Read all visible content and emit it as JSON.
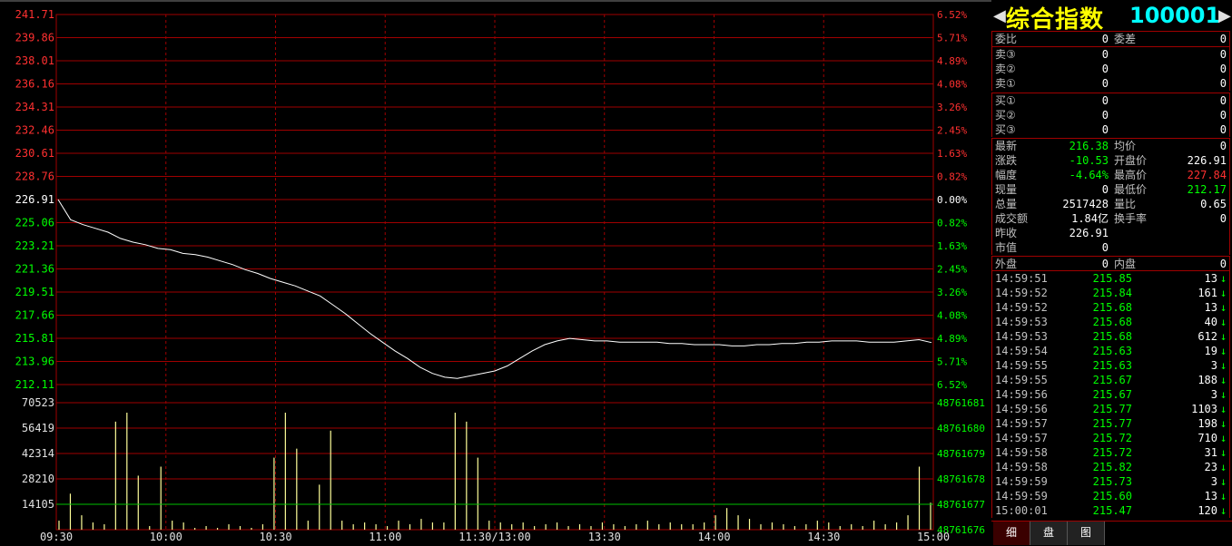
{
  "chart_data": {
    "type": "line",
    "price_axis": {
      "labels": [
        "241.71",
        "239.86",
        "238.01",
        "236.16",
        "234.31",
        "232.46",
        "230.61",
        "228.76",
        "226.91",
        "225.06",
        "223.21",
        "221.36",
        "219.51",
        "217.66",
        "215.81",
        "213.96",
        "212.11"
      ],
      "pct_labels": [
        "6.52%",
        "5.71%",
        "4.89%",
        "4.08%",
        "3.26%",
        "2.45%",
        "1.63%",
        "0.82%",
        "0.00%",
        "0.82%",
        "1.63%",
        "2.45%",
        "3.26%",
        "4.08%",
        "4.89%",
        "5.71%",
        "6.52%"
      ],
      "prev_close": 226.91,
      "ylim": [
        212.11,
        241.71
      ]
    },
    "volume_axis": {
      "labels": [
        "70523",
        "56419",
        "42314",
        "28210",
        "14105"
      ],
      "right_labels": [
        "48761681",
        "48761680",
        "48761679",
        "48761678",
        "48761677",
        "48761676"
      ],
      "ylim": [
        0,
        70523
      ]
    },
    "time_labels": [
      "09:30",
      "10:00",
      "10:30",
      "11:00",
      "11:30/13:00",
      "13:30",
      "14:00",
      "14:30",
      "15:00"
    ],
    "price_series": [
      226.91,
      225.3,
      224.9,
      224.6,
      224.3,
      223.8,
      223.5,
      223.3,
      223.0,
      222.9,
      222.6,
      222.5,
      222.3,
      222.0,
      221.7,
      221.3,
      221.0,
      220.6,
      220.3,
      220.0,
      219.6,
      219.2,
      218.5,
      217.8,
      217.0,
      216.2,
      215.5,
      214.8,
      214.2,
      213.5,
      213.0,
      212.7,
      212.6,
      212.8,
      213.0,
      213.2,
      213.6,
      214.2,
      214.8,
      215.3,
      215.6,
      215.8,
      215.7,
      215.6,
      215.6,
      215.5,
      215.5,
      215.5,
      215.5,
      215.4,
      215.4,
      215.3,
      215.3,
      215.3,
      215.2,
      215.2,
      215.3,
      215.3,
      215.4,
      215.4,
      215.5,
      215.5,
      215.6,
      215.6,
      215.6,
      215.5,
      215.5,
      215.5,
      215.6,
      215.7,
      215.47
    ],
    "volume_series": [
      5000,
      20000,
      8000,
      4000,
      3000,
      60000,
      65000,
      30000,
      2000,
      35000,
      5000,
      4000,
      1000,
      2000,
      1000,
      3000,
      2000,
      1000,
      3000,
      40000,
      65000,
      45000,
      5000,
      25000,
      55000,
      5000,
      3000,
      4000,
      3000,
      2000,
      5000,
      3000,
      6000,
      4000,
      4000,
      65000,
      60000,
      40000,
      5000,
      4000,
      3000,
      4000,
      2000,
      3000,
      4000,
      2000,
      3000,
      2000,
      4000,
      3000,
      2000,
      3000,
      5000,
      3000,
      4000,
      3000,
      3000,
      4000,
      8000,
      12000,
      8000,
      6000,
      3000,
      4000,
      3000,
      2000,
      3000,
      5000,
      4000,
      2000,
      3000,
      2000,
      5000,
      3000,
      4000,
      8000,
      35000,
      15000
    ],
    "avg_volume": 14105,
    "grid": true
  },
  "panel": {
    "title": "综合指数",
    "code": "100001",
    "order_book": {
      "ratio": {
        "label": "委比",
        "value": "0",
        "label2": "委差",
        "value2": "0"
      },
      "sells": [
        {
          "label": "卖③",
          "price": "0",
          "vol": "0"
        },
        {
          "label": "卖②",
          "price": "0",
          "vol": "0"
        },
        {
          "label": "卖①",
          "price": "0",
          "vol": "0"
        }
      ],
      "buys": [
        {
          "label": "买①",
          "price": "0",
          "vol": "0"
        },
        {
          "label": "买②",
          "price": "0",
          "vol": "0"
        },
        {
          "label": "买③",
          "price": "0",
          "vol": "0"
        }
      ]
    },
    "stats": [
      {
        "l1": "最新",
        "v1": "216.38",
        "c1": "dn",
        "l2": "均价",
        "v2": "0",
        "c2": "wh"
      },
      {
        "l1": "涨跌",
        "v1": "-10.53",
        "c1": "dn",
        "l2": "开盘价",
        "v2": "226.91",
        "c2": "wh"
      },
      {
        "l1": "幅度",
        "v1": "-4.64%",
        "c1": "dn",
        "l2": "最高价",
        "v2": "227.84",
        "c2": "up"
      },
      {
        "l1": "现量",
        "v1": "0",
        "c1": "wh",
        "l2": "最低价",
        "v2": "212.17",
        "c2": "dn"
      },
      {
        "l1": "总量",
        "v1": "2517428",
        "c1": "wh",
        "l2": "量比",
        "v2": "0.65",
        "c2": "wh"
      },
      {
        "l1": "成交额",
        "v1": "1.84亿",
        "c1": "wh",
        "l2": "换手率",
        "v2": "0",
        "c2": "wh"
      },
      {
        "l1": "昨收",
        "v1": "226.91",
        "c1": "wh",
        "l2": "",
        "v2": "",
        "c2": "wh"
      },
      {
        "l1": "市值",
        "v1": "0",
        "c1": "wh",
        "l2": "",
        "v2": "",
        "c2": "wh"
      }
    ],
    "inout": {
      "l1": "外盘",
      "v1": "0",
      "l2": "内盘",
      "v2": "0"
    },
    "ticks": [
      {
        "time": "14:59:51",
        "price": "215.85",
        "vol": "13"
      },
      {
        "time": "14:59:52",
        "price": "215.84",
        "vol": "161"
      },
      {
        "time": "14:59:52",
        "price": "215.68",
        "vol": "13"
      },
      {
        "time": "14:59:53",
        "price": "215.68",
        "vol": "40"
      },
      {
        "time": "14:59:53",
        "price": "215.68",
        "vol": "612"
      },
      {
        "time": "14:59:54",
        "price": "215.63",
        "vol": "19"
      },
      {
        "time": "14:59:55",
        "price": "215.63",
        "vol": "3"
      },
      {
        "time": "14:59:55",
        "price": "215.67",
        "vol": "188"
      },
      {
        "time": "14:59:56",
        "price": "215.67",
        "vol": "3"
      },
      {
        "time": "14:59:56",
        "price": "215.77",
        "vol": "1103"
      },
      {
        "time": "14:59:57",
        "price": "215.77",
        "vol": "198"
      },
      {
        "time": "14:59:57",
        "price": "215.72",
        "vol": "710"
      },
      {
        "time": "14:59:58",
        "price": "215.72",
        "vol": "31"
      },
      {
        "time": "14:59:58",
        "price": "215.82",
        "vol": "23"
      },
      {
        "time": "14:59:59",
        "price": "215.73",
        "vol": "3"
      },
      {
        "time": "14:59:59",
        "price": "215.60",
        "vol": "13"
      },
      {
        "time": "15:00:01",
        "price": "215.47",
        "vol": "120"
      }
    ],
    "tick_arrow": "↓",
    "tabs": [
      "细",
      "盘",
      "图"
    ]
  },
  "colors": {
    "grid": "#a00000",
    "up": "#ff3030",
    "down": "#00ff00",
    "line": "#ffffff",
    "volume": "#ffff99",
    "avg": "#00c000"
  }
}
